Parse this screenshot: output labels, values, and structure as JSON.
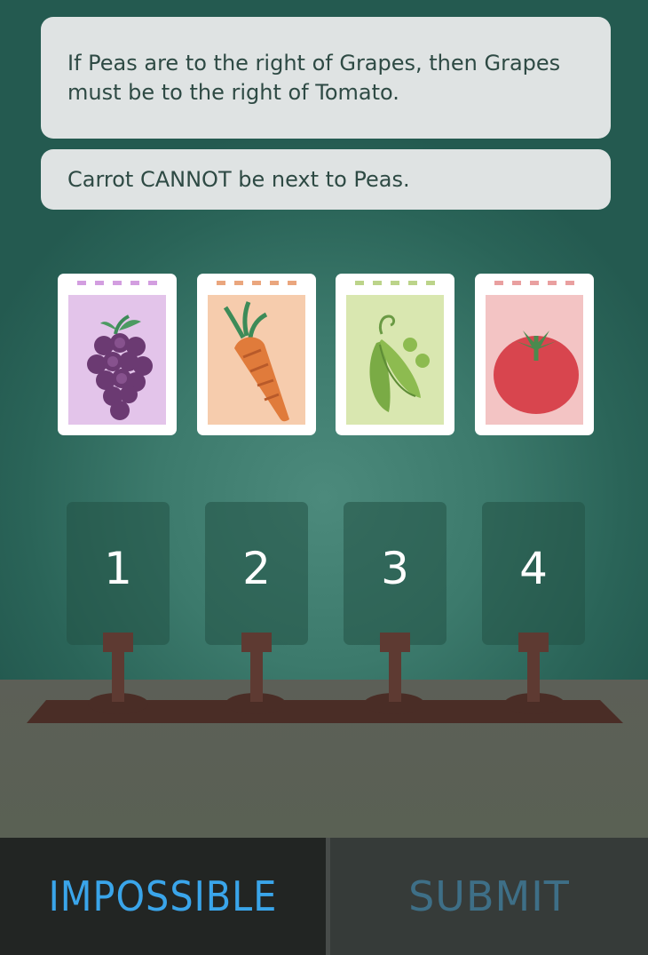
{
  "clues": [
    {
      "text": "If Peas are to the right of Grapes, then Grapes must be to the right of Tomato."
    },
    {
      "text": "Carrot CANNOT be next to Peas."
    }
  ],
  "packets": [
    {
      "name": "Grapes",
      "icon": "grapes-icon",
      "art_color": "#e3c4ea",
      "dash_color": "#d39ee0"
    },
    {
      "name": "Carrot",
      "icon": "carrot-icon",
      "art_color": "#f6ccad",
      "dash_color": "#eaa67e"
    },
    {
      "name": "Peas",
      "icon": "peas-icon",
      "art_color": "#d9e7b0",
      "dash_color": "#bcd48a"
    },
    {
      "name": "Tomato",
      "icon": "tomato-icon",
      "art_color": "#f3c4c4",
      "dash_color": "#e9a0a0"
    }
  ],
  "slots": [
    "1",
    "2",
    "3",
    "4"
  ],
  "buttons": {
    "impossible_label": "IMPOSSIBLE",
    "submit_label": "SUBMIT"
  },
  "colors": {
    "accent_blue": "#3aa5ea",
    "submit_blue": "#3e6f87",
    "soil": "#4a2d26"
  }
}
